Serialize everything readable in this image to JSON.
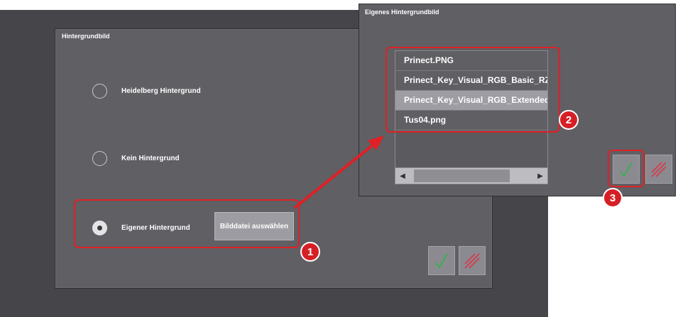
{
  "background_dialog": {
    "title": "Hintergrundbild",
    "options": [
      {
        "label": "Heidelberg Hintergrund",
        "selected": false
      },
      {
        "label": "Kein Hintergrund",
        "selected": false
      },
      {
        "label": "Eigener Hintergrund",
        "selected": true
      }
    ],
    "choose_file_label": "Bilddatei auswählen"
  },
  "file_dialog": {
    "title": "Eigenes Hintergrundbild",
    "files": [
      {
        "name": "Prinect.PNG",
        "selected": false
      },
      {
        "name": "Prinect_Key_Visual_RGB_Basic_RZ.png",
        "selected": false
      },
      {
        "name": "Prinect_Key_Visual_RGB_Extended_RZ.png",
        "selected": true
      },
      {
        "name": "Tus04.png",
        "selected": false
      }
    ]
  },
  "callouts": {
    "step1": "1",
    "step2": "2",
    "step3": "3"
  },
  "colors": {
    "accent": "#e02024",
    "confirm_green": "#33b24a",
    "cancel_red": "#d9384a"
  },
  "icons": {
    "confirm": "checkmark-icon",
    "cancel": "cancel-hatch-icon"
  }
}
